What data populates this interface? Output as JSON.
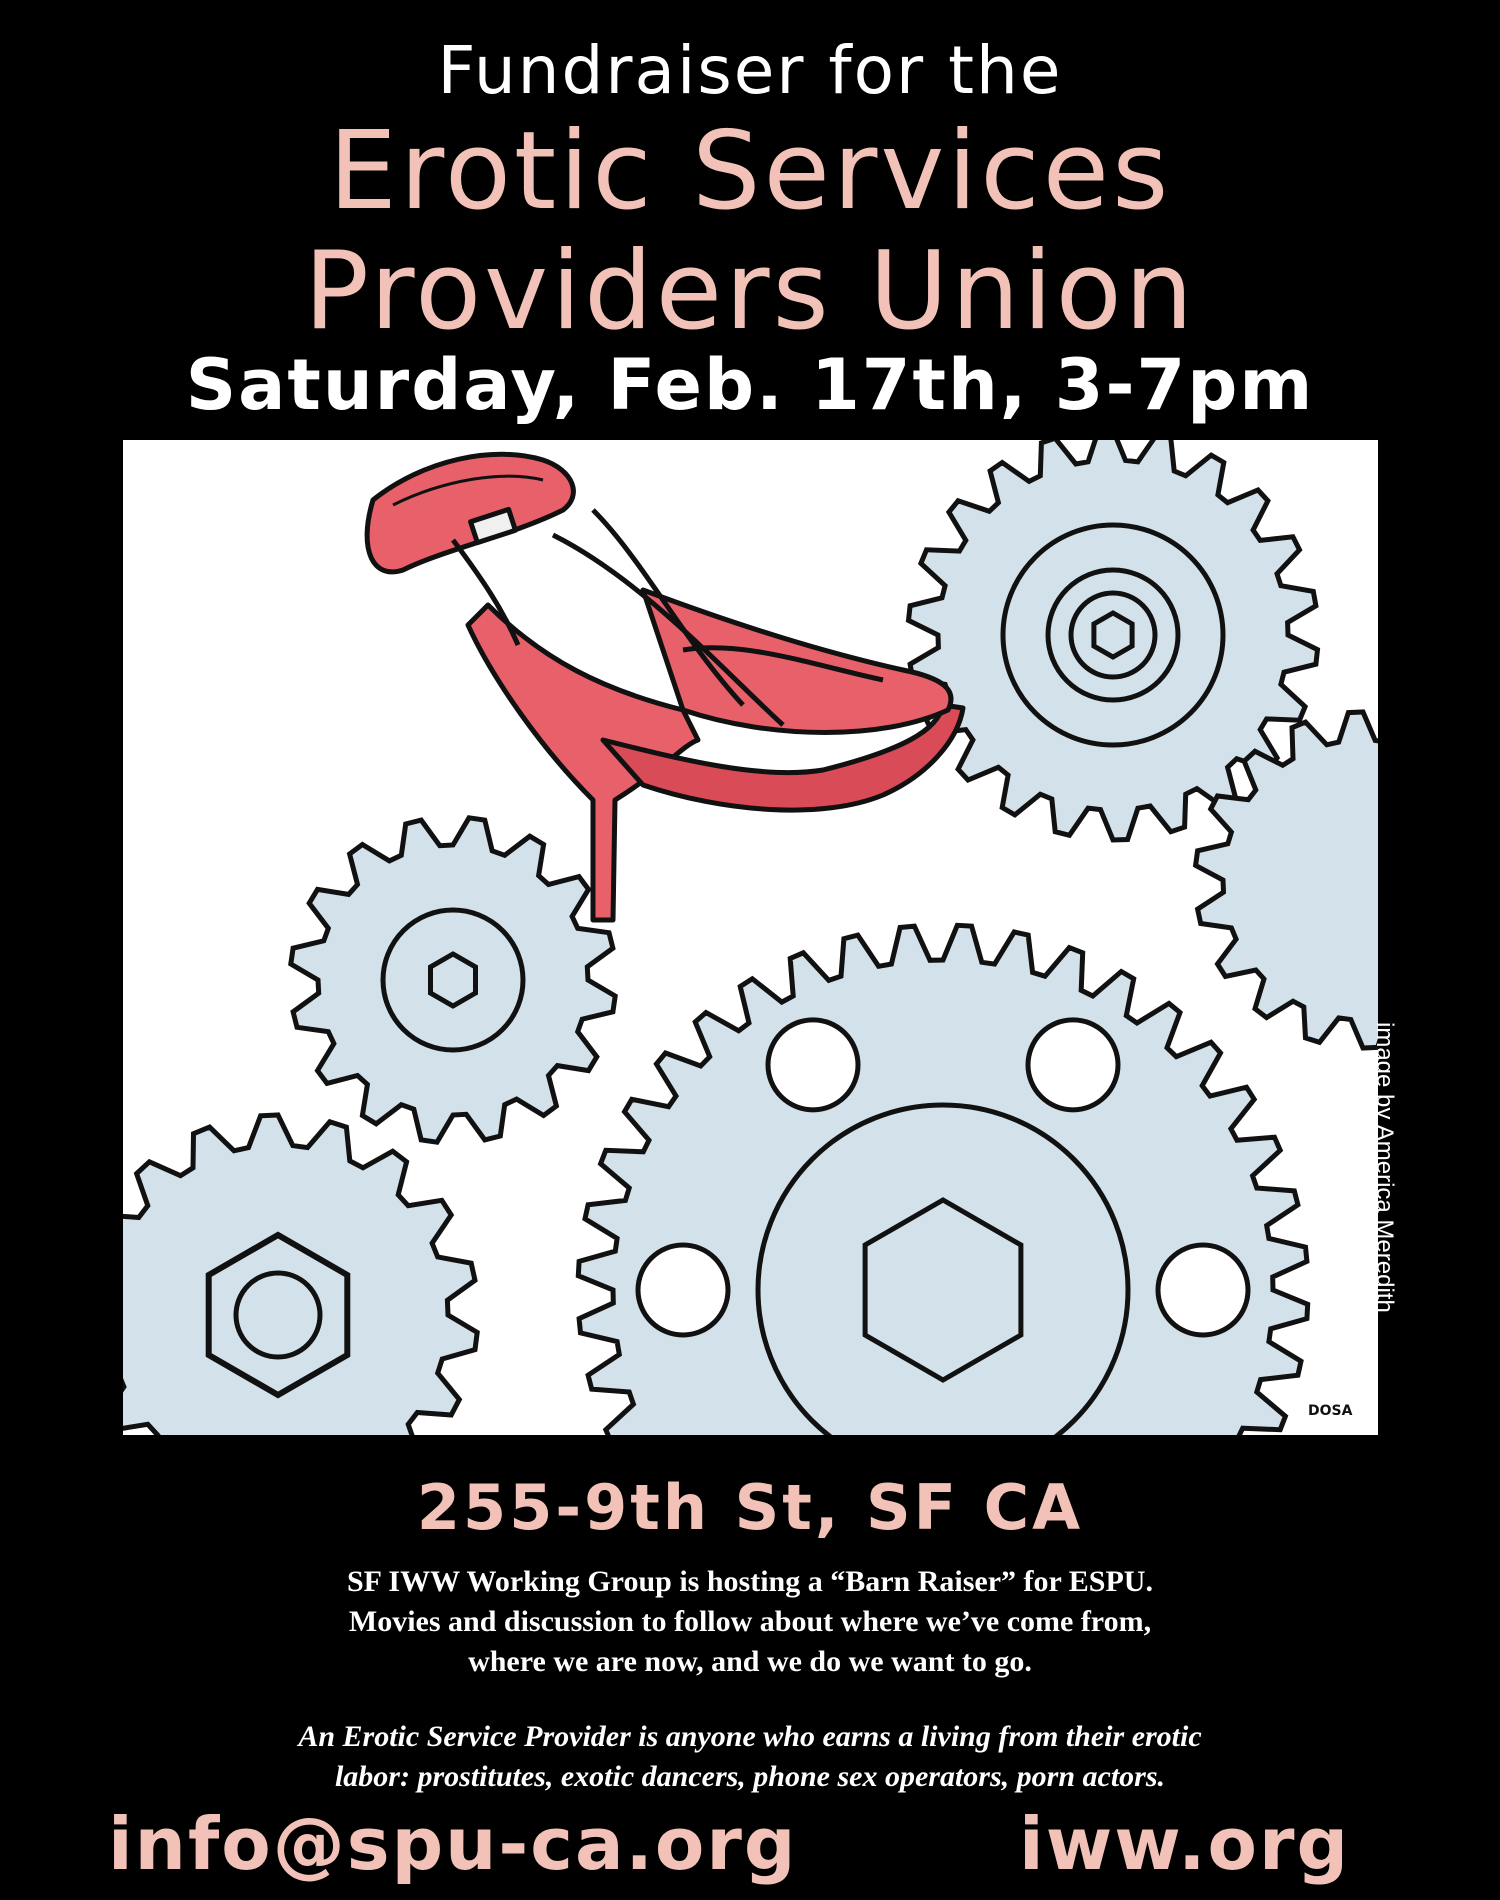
{
  "header": {
    "line1": "Fundraiser for the",
    "line2": "Erotic Services",
    "line3": "Providers Union",
    "date": "Saturday, Feb. 17th, 3-7pm"
  },
  "artwork": {
    "credit": "image by America Meredith",
    "signature": "DOSA",
    "colors": {
      "gear": "#d3e2ea",
      "shoe": "#e8606a",
      "outline": "#111111"
    }
  },
  "address": "255-9th St, SF CA",
  "description": [
    "SF IWW Working Group is hosting a “Barn Raiser” for ESPU.",
    "Movies and discussion to follow about where we’ve come from,",
    "where we are now, and we do we want to go."
  ],
  "definition": [
    "An Erotic Service Provider is anyone who earns a living from their erotic",
    "labor: prostitutes, exotic dancers, phone sex operators, porn actors."
  ],
  "contact": {
    "email": "info@spu-ca.org",
    "website": "iww.org"
  },
  "theme": {
    "background": "#000000",
    "accent": "#f2c2b8",
    "text": "#ffffff"
  }
}
